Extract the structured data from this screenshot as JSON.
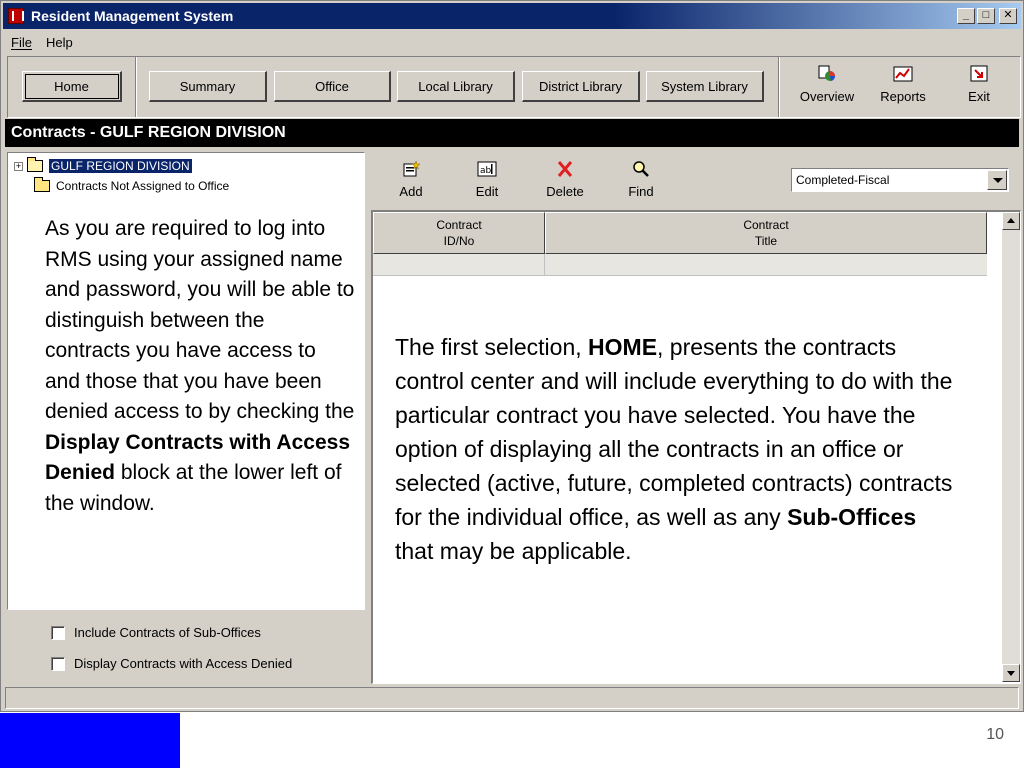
{
  "window": {
    "title": "Resident Management System",
    "caption_buttons": {
      "minimize": "_",
      "maximize": "□",
      "close": "✕"
    }
  },
  "menu": {
    "file": "File",
    "help": "Help"
  },
  "toolbar": {
    "home": "Home",
    "summary": "Summary",
    "office": "Office",
    "local_library": "Local Library",
    "district_library": "District Library",
    "system_library": "System Library",
    "overview": "Overview",
    "reports": "Reports",
    "exit": "Exit"
  },
  "section_title": "Contracts - GULF REGION DIVISION",
  "tree": {
    "root": "GULF REGION DIVISION",
    "child": "Contracts Not Assigned to Office"
  },
  "left_note": {
    "part1": "As you are required to log into RMS using your assigned name and password, you will be able to distinguish between the contracts you have access to and those that you have been denied access to by checking the ",
    "bold": "Display Contracts with Access Denied",
    "part2": " block at the lower left of the window."
  },
  "options": {
    "include_sub_offices": "Include Contracts of Sub-Offices",
    "display_access_denied": "Display Contracts with Access Denied"
  },
  "contract_toolbar": {
    "add": "Add",
    "edit": "Edit",
    "delete": "Delete",
    "find": "Find",
    "filter_selected": "Completed-Fiscal"
  },
  "grid": {
    "columns": [
      {
        "line1": "Contract",
        "line2": "ID/No"
      },
      {
        "line1": "Contract",
        "line2": "Title"
      }
    ]
  },
  "right_note": {
    "part1": "The first selection, ",
    "bold1": "HOME",
    "part2": ", presents the contracts control center and will include everything to do with the particular contract you have selected. You have the option of displaying all the contracts in an office or selected (active, future, completed contracts) contracts for the individual office, as well as any ",
    "bold2": "Sub-Offices",
    "part3": " that may be applicable."
  },
  "page_number": "10",
  "colors": {
    "titlebar": "#0a246a",
    "footer_accent": "#0000ff",
    "window_face": "#d4d0c8"
  },
  "icons": [
    "app-icon",
    "overview-icon",
    "reports-icon",
    "exit-icon",
    "add-icon",
    "edit-icon",
    "delete-icon",
    "find-icon",
    "folder-icon"
  ]
}
